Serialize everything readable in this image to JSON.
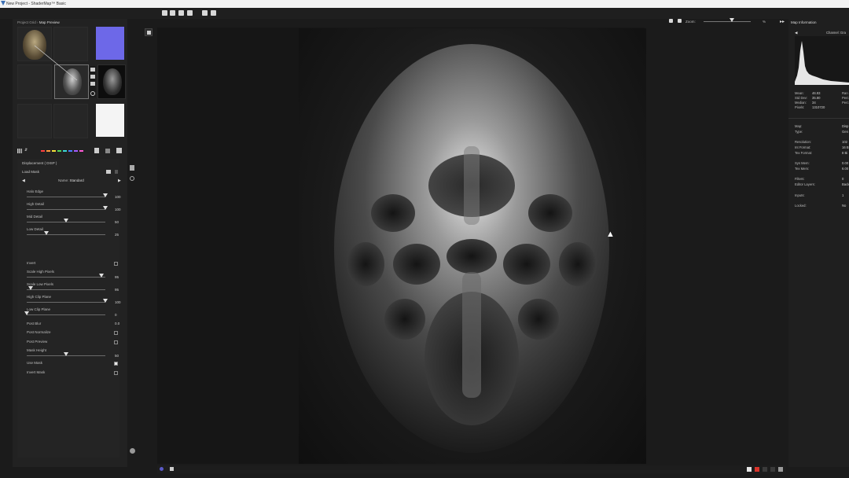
{
  "window": {
    "title": "New Project - ShaderMap™ Basic"
  },
  "breadcrumb": {
    "root": "Project Grid",
    "sep": "›",
    "current": "Map Preview"
  },
  "toolbar": {
    "icons": [
      "new-file-icon",
      "open-folder-icon",
      "save-icon",
      "save-as-icon",
      "tools-icon",
      "copy-icon"
    ],
    "zoom_label": "Zoom:",
    "zoom_value": "%",
    "zoom_level": 0.6
  },
  "map_grid": {
    "icons": [
      "grid-view-icon",
      "sort-icon",
      "export-icon",
      "batch-icon",
      "render-icon"
    ],
    "color_dots": [
      "#ff4040",
      "#ff9b3d",
      "#f4e03a",
      "#52d85a",
      "#3ad8d8",
      "#4b7dff",
      "#a45bff",
      "#ff5bd6"
    ]
  },
  "map_properties": {
    "title": "Displacement ( DISP )",
    "load_mask": "Load Mask",
    "preset_label": "Name:",
    "preset_value": "Standard",
    "sliders": [
      {
        "label": "Halo Edge",
        "value": "100",
        "fraction": 1.0
      },
      {
        "label": "High Detail",
        "value": "100",
        "fraction": 1.0
      },
      {
        "label": "Mid Detail",
        "value": "50",
        "fraction": 0.5
      },
      {
        "label": "Low Detail",
        "value": "25",
        "fraction": 0.25
      }
    ],
    "invert_label": "Invert",
    "sliders2": [
      {
        "label": "Scale High Pixels",
        "value": "95",
        "fraction": 0.95
      },
      {
        "label": "Scale Low Pixels",
        "value": "95",
        "fraction": 0.05
      },
      {
        "label": "High Clip Plane",
        "value": "100",
        "fraction": 1.0
      },
      {
        "label": "Low Clip Plane",
        "value": "0",
        "fraction": 0.0
      }
    ],
    "post_blur_label": "Post Blur",
    "post_blur_value": "0.0",
    "post_normalize_label": "Post Normalize",
    "post_preview_label": "Post Preview",
    "mask_height_label": "Mask Height",
    "mask_height_value": "50",
    "mask_height_fraction": 0.5,
    "use_mask_label": "Use Mask",
    "invert_mask_label": "Invert Mask"
  },
  "info_panel": {
    "title": "Map Information",
    "channel_label": "Channel: Gra",
    "stats": [
      {
        "label": "Mean:",
        "value": "46.93"
      },
      {
        "label": "Std Dev:",
        "value": "35.80"
      },
      {
        "label": "Median:",
        "value": "34"
      },
      {
        "label": "Pixels:",
        "value": "1310720"
      }
    ],
    "stats_right": [
      "Ran",
      "Perc",
      "Perc"
    ],
    "props": [
      {
        "label": "Map:",
        "value": "Disp"
      },
      {
        "label": "Type:",
        "value": "Gen"
      },
      {
        "label": "Resolution:",
        "value": "102"
      },
      {
        "label": "Int Format:",
        "value": "16 B"
      },
      {
        "label": "Tex Format:",
        "value": "8 Bi"
      },
      {
        "label": "Sys Mem:",
        "value": "0.00"
      },
      {
        "label": "Tex Mem:",
        "value": "6.00"
      },
      {
        "label": "Filters:",
        "value": "0"
      },
      {
        "label": "Editor Layers:",
        "value": "Back"
      },
      {
        "label": "Inputs:",
        "value": "1"
      },
      {
        "label": "Locked:",
        "value": "No"
      }
    ]
  },
  "bottom_bar": {
    "status_colors": [
      "#e5e5e5",
      "#d9342b",
      "#3a3a3a",
      "#3a3a3a",
      "#9a9a9a"
    ]
  }
}
